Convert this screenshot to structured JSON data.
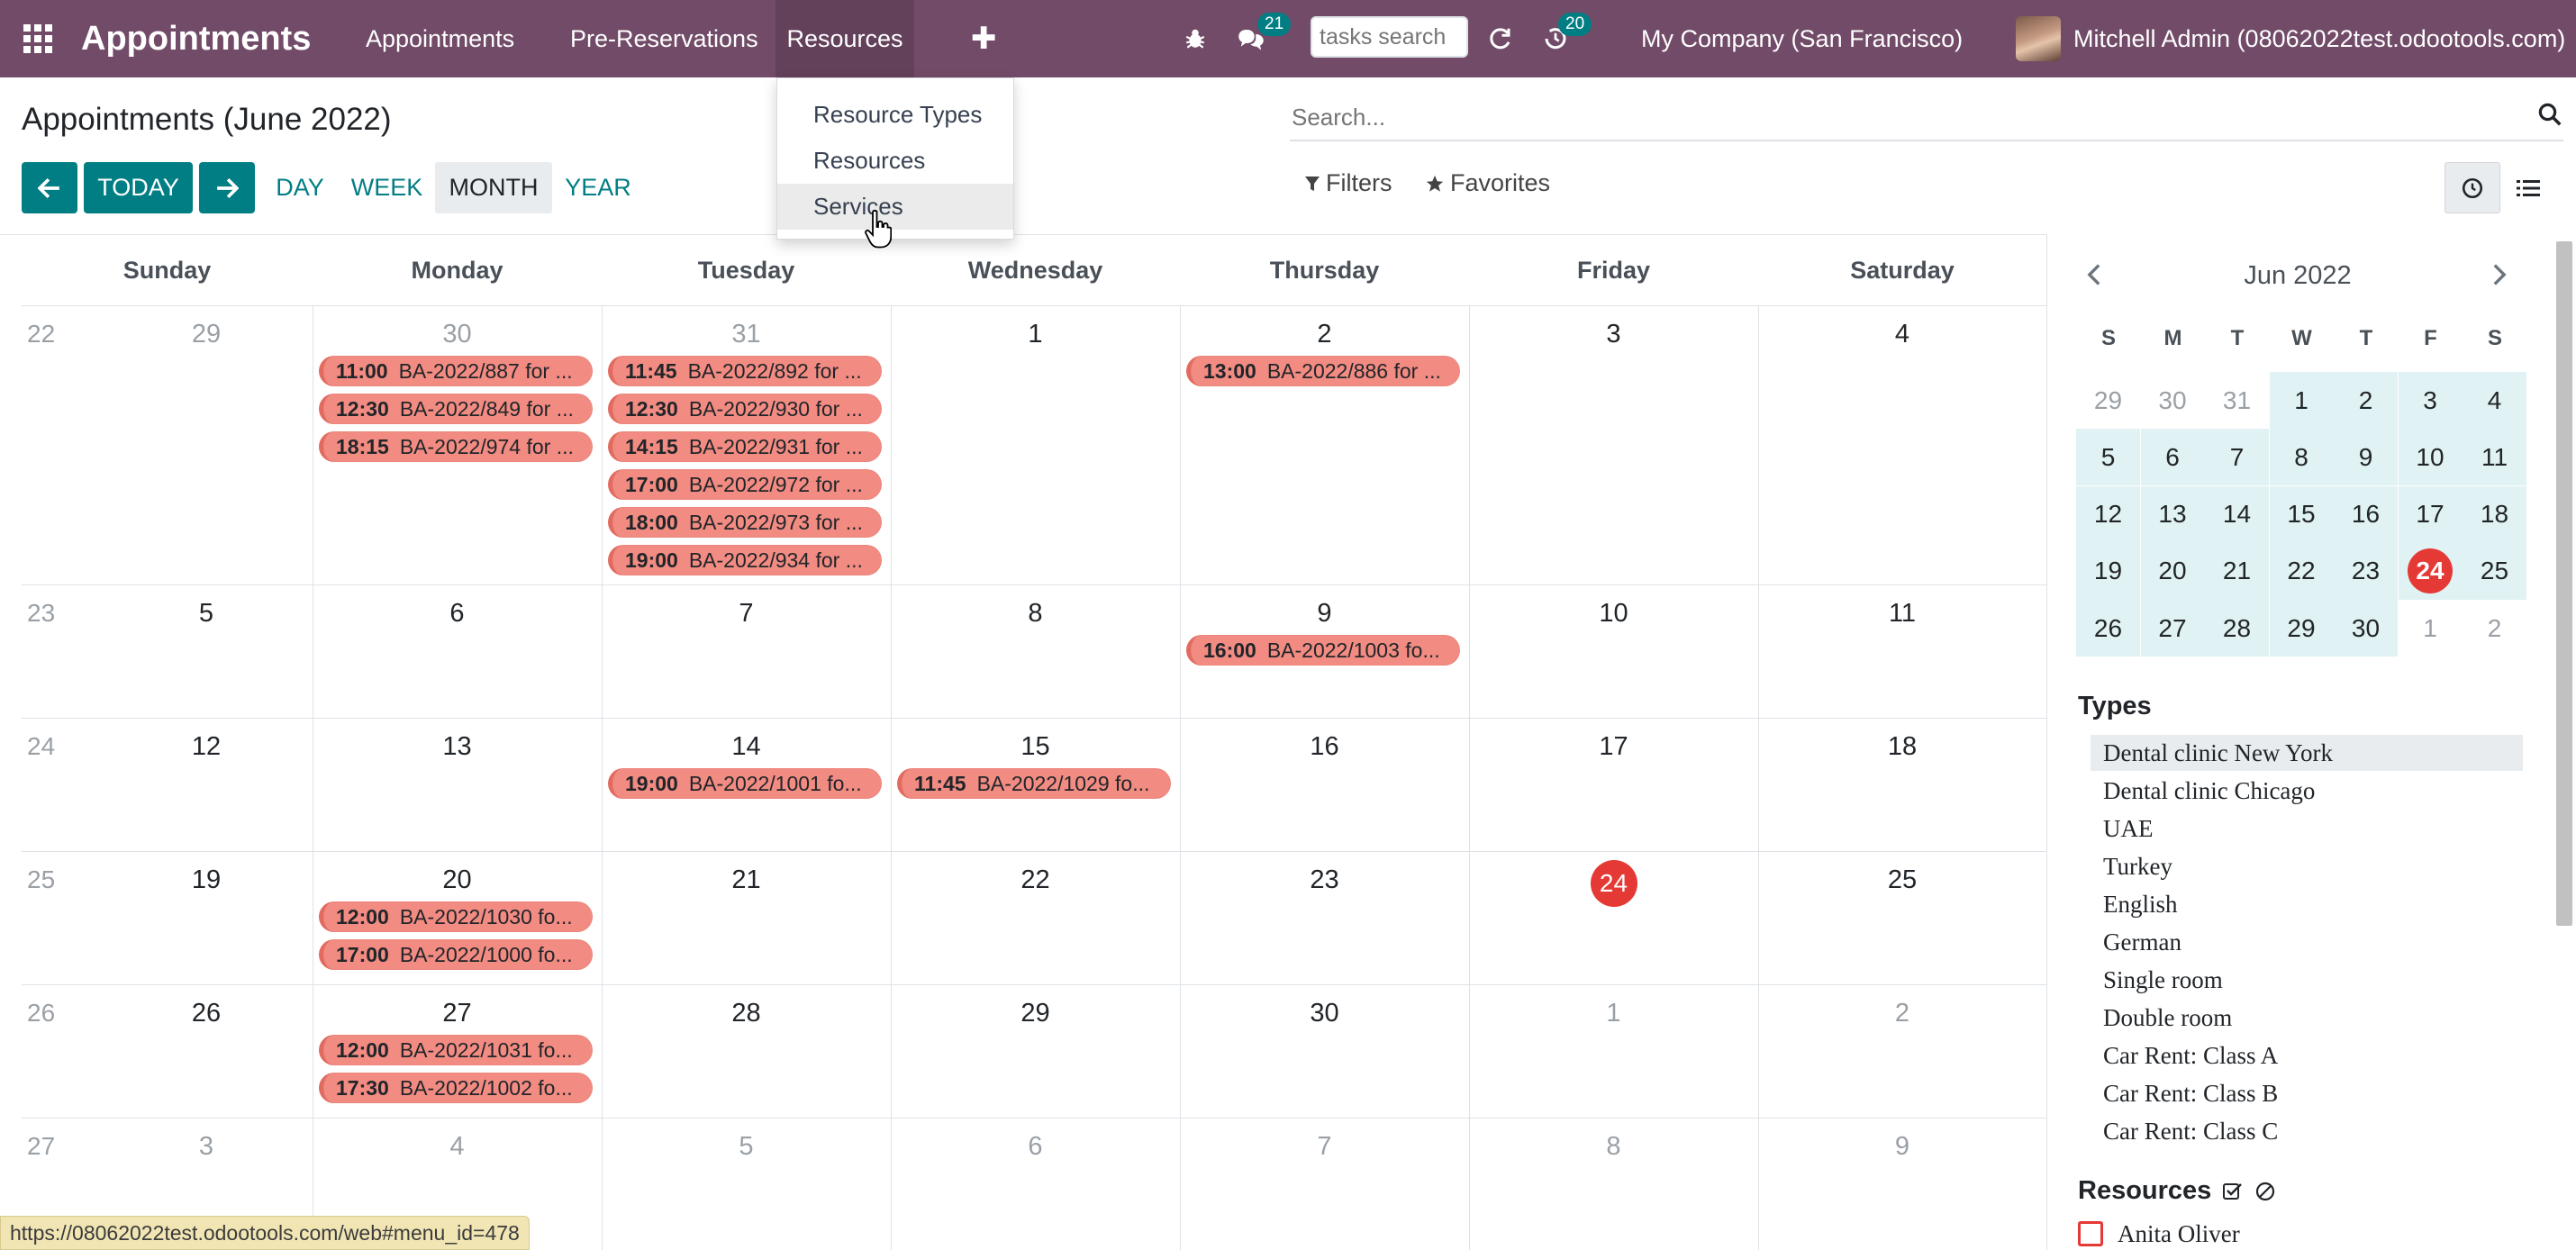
{
  "app": {
    "name": "Appointments"
  },
  "topnav": {
    "menus": [
      "Appointments",
      "Pre-Reservations",
      "Resources"
    ],
    "messages_count": "21",
    "activity_count": "20",
    "tasks_search_placeholder": "tasks search",
    "company": "My Company (San Francisco)",
    "user": "Mitchell Admin (08062022test.odootools.com)"
  },
  "dropdown": {
    "items": [
      "Resource Types",
      "Resources",
      "Services"
    ]
  },
  "control": {
    "title": "Appointments (June 2022)",
    "today_label": "TODAY",
    "scales": [
      "DAY",
      "WEEK",
      "MONTH",
      "YEAR"
    ],
    "active_scale": "MONTH",
    "search_placeholder": "Search...",
    "filters_label": "Filters",
    "favorites_label": "Favorites"
  },
  "calendar": {
    "day_headers": [
      "Sunday",
      "Monday",
      "Tuesday",
      "Wednesday",
      "Thursday",
      "Friday",
      "Saturday"
    ],
    "week_numbers": [
      "22",
      "23",
      "24",
      "25",
      "26",
      "27"
    ],
    "weeks": [
      [
        "29",
        "30",
        "31",
        "1",
        "2",
        "3",
        "4"
      ],
      [
        "5",
        "6",
        "7",
        "8",
        "9",
        "10",
        "11"
      ],
      [
        "12",
        "13",
        "14",
        "15",
        "16",
        "17",
        "18"
      ],
      [
        "19",
        "20",
        "21",
        "22",
        "23",
        "24",
        "25"
      ],
      [
        "26",
        "27",
        "28",
        "29",
        "30",
        "1",
        "2"
      ],
      [
        "3",
        "4",
        "5",
        "6",
        "7",
        "8",
        "9"
      ]
    ],
    "today": "24",
    "events": [
      {
        "week": 0,
        "day": 1,
        "slot": 0,
        "time": "11:00",
        "title": "BA-2022/887 for ..."
      },
      {
        "week": 0,
        "day": 1,
        "slot": 1,
        "time": "12:30",
        "title": "BA-2022/849 for ..."
      },
      {
        "week": 0,
        "day": 1,
        "slot": 2,
        "time": "18:15",
        "title": "BA-2022/974 for ..."
      },
      {
        "week": 0,
        "day": 2,
        "slot": 0,
        "time": "11:45",
        "title": "BA-2022/892 for ..."
      },
      {
        "week": 0,
        "day": 2,
        "slot": 1,
        "time": "12:30",
        "title": "BA-2022/930 for ..."
      },
      {
        "week": 0,
        "day": 2,
        "slot": 2,
        "time": "14:15",
        "title": "BA-2022/931 for ..."
      },
      {
        "week": 0,
        "day": 2,
        "slot": 3,
        "time": "17:00",
        "title": "BA-2022/972 for ..."
      },
      {
        "week": 0,
        "day": 2,
        "slot": 4,
        "time": "18:00",
        "title": "BA-2022/973 for ..."
      },
      {
        "week": 0,
        "day": 2,
        "slot": 5,
        "time": "19:00",
        "title": "BA-2022/934 for ..."
      },
      {
        "week": 0,
        "day": 4,
        "slot": 0,
        "time": "13:00",
        "title": "BA-2022/886 for ..."
      },
      {
        "week": 1,
        "day": 4,
        "slot": 0,
        "time": "16:00",
        "title": "BA-2022/1003 fo..."
      },
      {
        "week": 2,
        "day": 2,
        "slot": 0,
        "time": "19:00",
        "title": "BA-2022/1001 fo..."
      },
      {
        "week": 2,
        "day": 3,
        "slot": 0,
        "time": "11:45",
        "title": "BA-2022/1029 fo..."
      },
      {
        "week": 3,
        "day": 1,
        "slot": 0,
        "time": "12:00",
        "title": "BA-2022/1030 fo..."
      },
      {
        "week": 3,
        "day": 1,
        "slot": 1,
        "time": "17:00",
        "title": "BA-2022/1000 fo..."
      },
      {
        "week": 4,
        "day": 1,
        "slot": 0,
        "time": "12:00",
        "title": "BA-2022/1031 fo..."
      },
      {
        "week": 4,
        "day": 1,
        "slot": 1,
        "time": "17:30",
        "title": "BA-2022/1002 fo..."
      }
    ]
  },
  "mini_calendar": {
    "title": "Jun 2022",
    "dow": [
      "S",
      "M",
      "T",
      "W",
      "T",
      "F",
      "S"
    ],
    "weeks": [
      [
        "29",
        "30",
        "31",
        "1",
        "2",
        "3",
        "4"
      ],
      [
        "5",
        "6",
        "7",
        "8",
        "9",
        "10",
        "11"
      ],
      [
        "12",
        "13",
        "14",
        "15",
        "16",
        "17",
        "18"
      ],
      [
        "19",
        "20",
        "21",
        "22",
        "23",
        "24",
        "25"
      ],
      [
        "26",
        "27",
        "28",
        "29",
        "30",
        "1",
        "2"
      ]
    ],
    "today": "24"
  },
  "types": {
    "title": "Types",
    "items": [
      "Dental clinic New York",
      "Dental clinic Chicago",
      "UAE",
      "Turkey",
      "English",
      "German",
      "Single room",
      "Double room",
      "Car Rent: Class A",
      "Car Rent: Class B",
      "Car Rent: Class C"
    ]
  },
  "resources": {
    "title": "Resources",
    "items": [
      "Anita Oliver"
    ]
  },
  "status_url": "https://08062022test.odootools.com/web#menu_id=478"
}
